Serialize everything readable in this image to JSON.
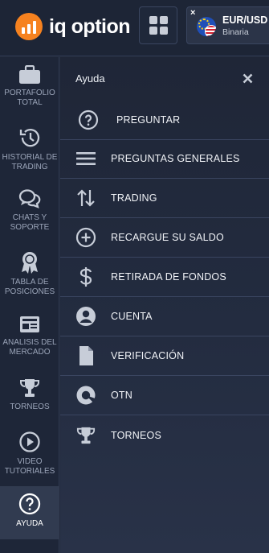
{
  "header": {
    "logo_text": "iq option",
    "brand_color": "#f6821f",
    "asset": {
      "name": "EUR/USD",
      "type": "Binaria",
      "close_symbol": "×"
    }
  },
  "sidebar": {
    "items": [
      {
        "label": "PORTAFOLIO TOTAL",
        "icon": "briefcase-icon"
      },
      {
        "label": "HISTORIAL DE TRADING",
        "icon": "history-icon"
      },
      {
        "label": "CHATS Y SOPORTE",
        "icon": "chat-icon"
      },
      {
        "label": "TABLA DE POSICIONES",
        "icon": "medal-icon"
      },
      {
        "label": "ANALISIS DEL MERCADO",
        "icon": "newspaper-icon"
      },
      {
        "label": "TORNEOS",
        "icon": "trophy-icon"
      },
      {
        "label": "VIDEO TUTORIALES",
        "icon": "play-icon"
      },
      {
        "label": "AYUDA",
        "icon": "help-icon",
        "active": true
      }
    ]
  },
  "panel": {
    "title": "Ayuda",
    "items": [
      {
        "label": "PREGUNTAR",
        "icon": "question-icon"
      },
      {
        "label": "PREGUNTAS GENERALES",
        "icon": "list-icon"
      },
      {
        "label": "TRADING",
        "icon": "arrows-updown-icon"
      },
      {
        "label": "RECARGUE SU SALDO",
        "icon": "plus-circle-icon"
      },
      {
        "label": "RETIRADA DE FONDOS",
        "icon": "dollar-icon"
      },
      {
        "label": "CUENTA",
        "icon": "user-icon"
      },
      {
        "label": "VERIFICACIÓN",
        "icon": "document-icon"
      },
      {
        "label": "OTN",
        "icon": "otn-icon"
      },
      {
        "label": "TORNEOS",
        "icon": "trophy-icon"
      }
    ]
  }
}
